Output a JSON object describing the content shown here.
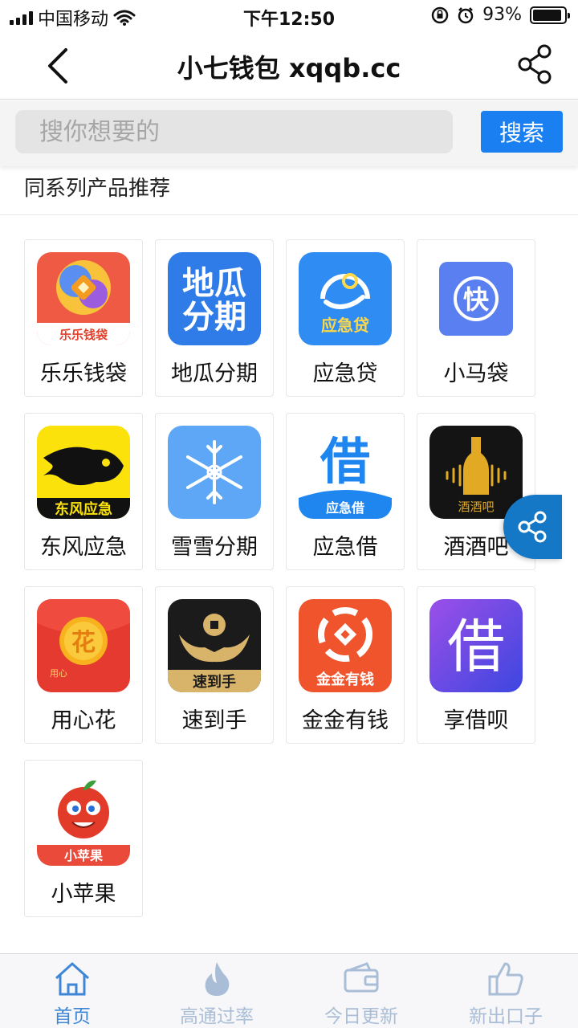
{
  "status_bar": {
    "carrier": "中国移动",
    "time": "下午12:50",
    "battery": "93%",
    "battery_level": 0.93
  },
  "nav": {
    "title": "小七钱包 xqqb.cc",
    "back_icon": "chevron-left-icon",
    "share_icon": "share-icon"
  },
  "search": {
    "placeholder": "搜你想要的",
    "button_label": "搜索"
  },
  "section": {
    "title": "同系列产品推荐"
  },
  "apps": [
    {
      "name": "乐乐钱袋",
      "icon_text": "乐乐钱袋"
    },
    {
      "name": "地瓜分期",
      "icon_text": "地瓜分期"
    },
    {
      "name": "应急贷",
      "icon_text": "应急贷"
    },
    {
      "name": "小马袋",
      "icon_text": "快"
    },
    {
      "name": "东风应急",
      "icon_text": "东风应急"
    },
    {
      "name": "雪雪分期",
      "icon_text": ""
    },
    {
      "name": "应急借",
      "icon_text": "应急借"
    },
    {
      "name": "酒酒吧",
      "icon_text": "酒酒吧"
    },
    {
      "name": "用心花",
      "icon_text": "花"
    },
    {
      "name": "速到手",
      "icon_text": "速到手"
    },
    {
      "name": "金金有钱",
      "icon_text": "金金有钱"
    },
    {
      "name": "享借呗",
      "icon_text": "借"
    },
    {
      "name": "小苹果",
      "icon_text": "小苹果"
    }
  ],
  "tabs": [
    {
      "label": "首页",
      "icon": "home-icon",
      "active": true
    },
    {
      "label": "高通过率",
      "icon": "flame-icon",
      "active": false
    },
    {
      "label": "今日更新",
      "icon": "wallet-icon",
      "active": false
    },
    {
      "label": "新出口子",
      "icon": "thumbs-up-icon",
      "active": false
    }
  ],
  "colors": {
    "accent": "#1a7ff0",
    "tab_active": "#3e86d6",
    "tab_inactive": "#a9bed6",
    "fab": "#1578c7"
  }
}
